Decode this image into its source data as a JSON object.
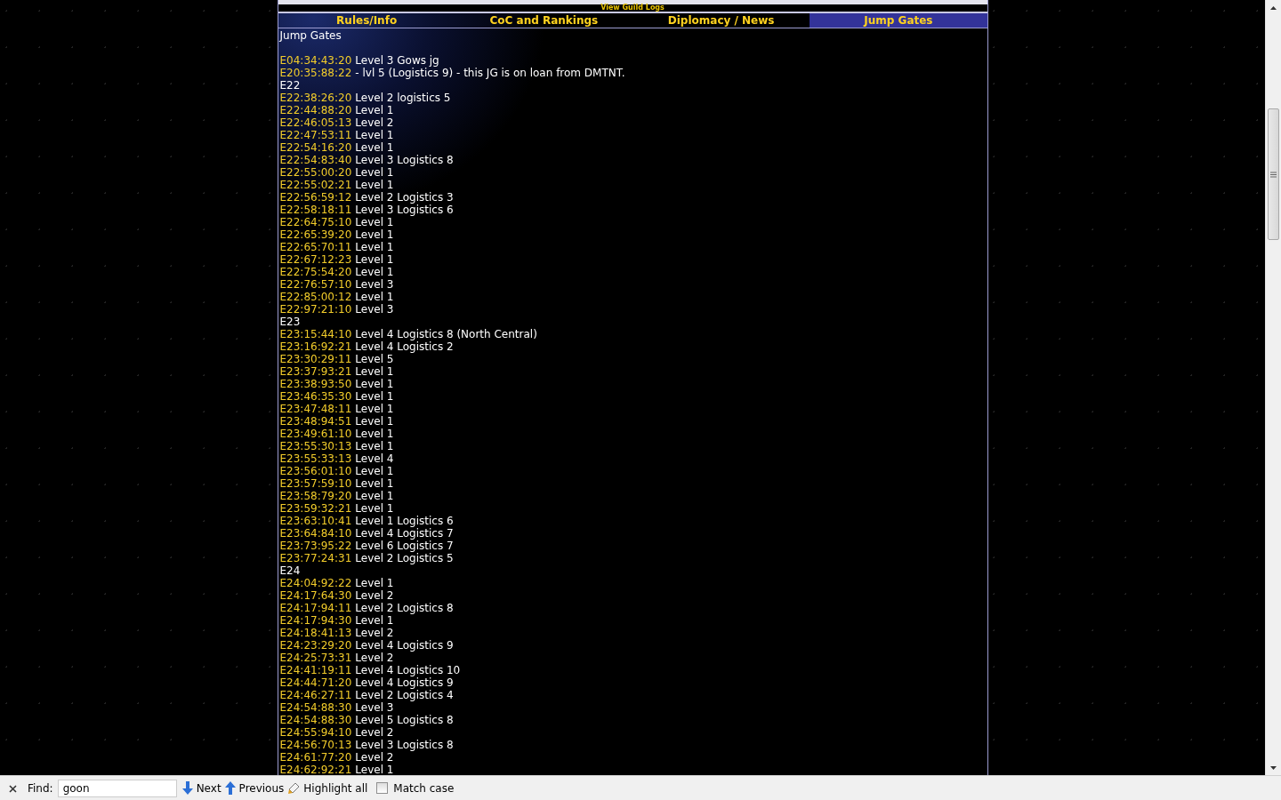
{
  "top_link": "View Guild Logs",
  "tabs": [
    {
      "label": "Rules/Info",
      "selected": false
    },
    {
      "label": "CoC and Rankings",
      "selected": false
    },
    {
      "label": "Diplomacy / News",
      "selected": false
    },
    {
      "label": "Jump Gates",
      "selected": true
    }
  ],
  "page_title": "Jump Gates",
  "entries": [
    {
      "kind": "gate",
      "coords": "E04:34:43:20",
      "note": "Level 3 Gows jg"
    },
    {
      "kind": "gate",
      "coords": "E20:35:88:22",
      "note": "- lvl 5 (Logistics 9) - this JG is on loan from DMTNT."
    },
    {
      "kind": "heading",
      "text": "E22"
    },
    {
      "kind": "gate",
      "coords": "E22:38:26:20",
      "note": "Level 2 logistics 5"
    },
    {
      "kind": "gate",
      "coords": "E22:44:88:20",
      "note": "Level 1"
    },
    {
      "kind": "gate",
      "coords": "E22:46:05:13",
      "note": "Level 2"
    },
    {
      "kind": "gate",
      "coords": "E22:47:53:11",
      "note": "Level 1"
    },
    {
      "kind": "gate",
      "coords": "E22:54:16:20",
      "note": "Level 1"
    },
    {
      "kind": "gate",
      "coords": "E22:54:83:40",
      "note": "Level 3 Logistics 8"
    },
    {
      "kind": "gate",
      "coords": "E22:55:00:20",
      "note": "Level 1"
    },
    {
      "kind": "gate",
      "coords": "E22:55:02:21",
      "note": "Level 1"
    },
    {
      "kind": "gate",
      "coords": "E22:56:59:12",
      "note": "Level 2 Logistics 3"
    },
    {
      "kind": "gate",
      "coords": "E22:58:18:11",
      "note": "Level 3 Logistics 6"
    },
    {
      "kind": "gate",
      "coords": "E22:64:75:10",
      "note": "Level 1"
    },
    {
      "kind": "gate",
      "coords": "E22:65:39:20",
      "note": "Level 1"
    },
    {
      "kind": "gate",
      "coords": "E22:65:70:11",
      "note": "Level 1"
    },
    {
      "kind": "gate",
      "coords": "E22:67:12:23",
      "note": "Level 1"
    },
    {
      "kind": "gate",
      "coords": "E22:75:54:20",
      "note": "Level 1"
    },
    {
      "kind": "gate",
      "coords": "E22:76:57:10",
      "note": "Level 3"
    },
    {
      "kind": "gate",
      "coords": "E22:85:00:12",
      "note": "Level 1"
    },
    {
      "kind": "gate",
      "coords": "E22:97:21:10",
      "note": "Level 3"
    },
    {
      "kind": "heading",
      "text": "E23"
    },
    {
      "kind": "gate",
      "coords": "E23:15:44:10",
      "note": "Level 4 Logistics 8 (North Central)"
    },
    {
      "kind": "gate",
      "coords": "E23:16:92:21",
      "note": "Level 4 Logistics 2"
    },
    {
      "kind": "gate",
      "coords": "E23:30:29:11",
      "note": "Level 5"
    },
    {
      "kind": "gate",
      "coords": "E23:37:93:21",
      "note": "Level 1"
    },
    {
      "kind": "gate",
      "coords": "E23:38:93:50",
      "note": "Level 1"
    },
    {
      "kind": "gate",
      "coords": "E23:46:35:30",
      "note": "Level 1"
    },
    {
      "kind": "gate",
      "coords": "E23:47:48:11",
      "note": "Level 1"
    },
    {
      "kind": "gate",
      "coords": "E23:48:94:51",
      "note": "Level 1"
    },
    {
      "kind": "gate",
      "coords": "E23:49:61:10",
      "note": "Level 1"
    },
    {
      "kind": "gate",
      "coords": "E23:55:30:13",
      "note": "Level 1"
    },
    {
      "kind": "gate",
      "coords": "E23:55:33:13",
      "note": "Level 4"
    },
    {
      "kind": "gate",
      "coords": "E23:56:01:10",
      "note": "Level 1"
    },
    {
      "kind": "gate",
      "coords": "E23:57:59:10",
      "note": "Level 1"
    },
    {
      "kind": "gate",
      "coords": "E23:58:79:20",
      "note": "Level 1"
    },
    {
      "kind": "gate",
      "coords": "E23:59:32:21",
      "note": "Level 1"
    },
    {
      "kind": "gate",
      "coords": "E23:63:10:41",
      "note": "Level 1 Logistics 6"
    },
    {
      "kind": "gate",
      "coords": "E23:64:84:10",
      "note": "Level 4 Logistics 7"
    },
    {
      "kind": "gate",
      "coords": "E23:73:95:22",
      "note": "Level 6 Logistics 7"
    },
    {
      "kind": "gate",
      "coords": "E23:77:24:31",
      "note": "Level 2 Logistics 5"
    },
    {
      "kind": "heading",
      "text": "E24"
    },
    {
      "kind": "gate",
      "coords": "E24:04:92:22",
      "note": "Level 1"
    },
    {
      "kind": "gate",
      "coords": "E24:17:64:30",
      "note": "Level 2"
    },
    {
      "kind": "gate",
      "coords": "E24:17:94:11",
      "note": "Level 2 Logistics 8"
    },
    {
      "kind": "gate",
      "coords": "E24:17:94:30",
      "note": "Level 1"
    },
    {
      "kind": "gate",
      "coords": "E24:18:41:13",
      "note": "Level 2"
    },
    {
      "kind": "gate",
      "coords": "E24:23:29:20",
      "note": "Level 4 Logistics 9"
    },
    {
      "kind": "gate",
      "coords": "E24:25:73:31",
      "note": "Level 2"
    },
    {
      "kind": "gate",
      "coords": "E24:41:19:11",
      "note": "Level 4 Logistics 10"
    },
    {
      "kind": "gate",
      "coords": "E24:44:71:20",
      "note": "Level 4 Logistics 9"
    },
    {
      "kind": "gate",
      "coords": "E24:46:27:11",
      "note": "Level 2 Logistics 4"
    },
    {
      "kind": "gate",
      "coords": "E24:54:88:30",
      "note": "Level 3"
    },
    {
      "kind": "gate",
      "coords": "E24:54:88:30",
      "note": "Level 5 Logistics 8"
    },
    {
      "kind": "gate",
      "coords": "E24:55:94:10",
      "note": "Level 2"
    },
    {
      "kind": "gate",
      "coords": "E24:56:70:13",
      "note": "Level 3 Logistics 8"
    },
    {
      "kind": "gate",
      "coords": "E24:61:77:20",
      "note": "Level 2"
    },
    {
      "kind": "gate",
      "coords": "E24:62:92:21",
      "note": "Level 1"
    }
  ],
  "find_bar": {
    "label": "Find:",
    "value": "goon",
    "buttons": [
      {
        "kind": "next",
        "label": "Next"
      },
      {
        "kind": "previous",
        "label": "Previous"
      },
      {
        "kind": "highlight",
        "label": "Highlight all"
      }
    ],
    "match_case": {
      "label": "Match case",
      "checked": false
    }
  }
}
